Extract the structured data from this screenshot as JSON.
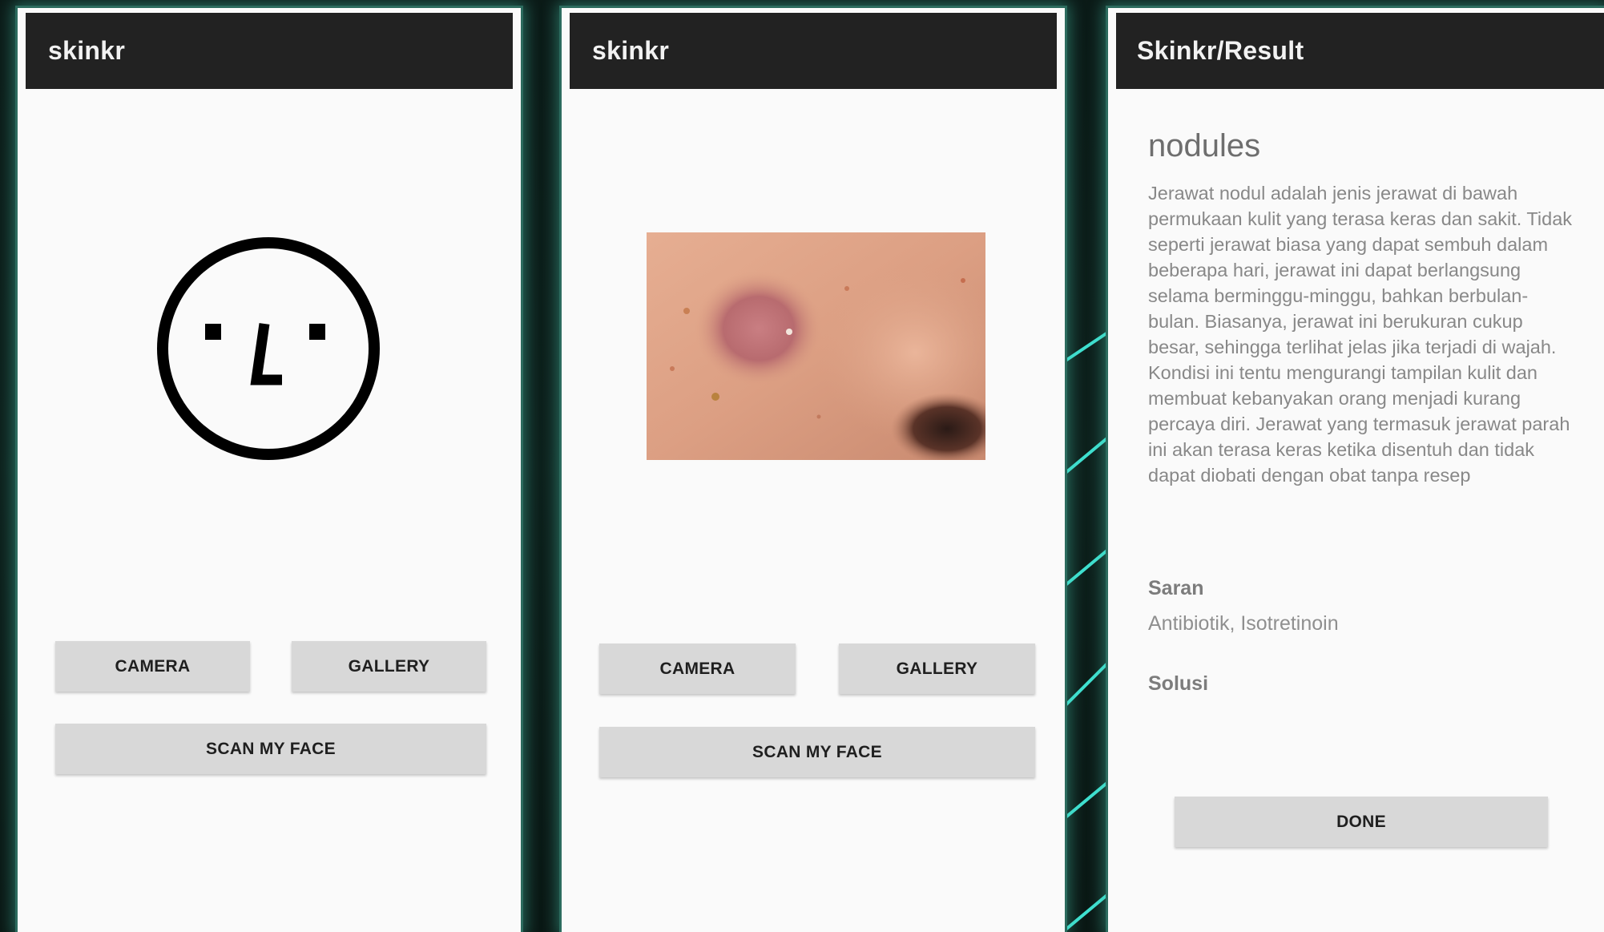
{
  "screens": [
    {
      "title": "skinkr",
      "buttons": {
        "camera": "CAMERA",
        "gallery": "GALLERY",
        "scan": "SCAN MY FACE"
      }
    },
    {
      "title": "skinkr",
      "buttons": {
        "camera": "CAMERA",
        "gallery": "GALLERY",
        "scan": "SCAN MY FACE"
      }
    },
    {
      "title": "Skinkr/Result",
      "result": {
        "condition": "nodules",
        "description": "Jerawat nodul adalah jenis jerawat di bawah permukaan kulit yang terasa keras dan sakit. Tidak seperti jerawat biasa yang dapat sembuh dalam beberapa hari, jerawat ini dapat berlangsung selama berminggu-minggu, bahkan berbulan-bulan. Biasanya, jerawat ini berukuran cukup besar, sehingga terlihat jelas jika terjadi di wajah. Kondisi ini tentu mengurangi tampilan kulit dan membuat kebanyakan orang menjadi kurang percaya diri. Jerawat yang termasuk jerawat parah ini akan terasa keras ketika disentuh dan tidak dapat diobati dengan obat tanpa resep",
        "saran_label": "Saran",
        "saran_value": "Antibiotik, Isotretinoin",
        "solusi_label": "Solusi"
      },
      "buttons": {
        "done": "DONE"
      }
    }
  ],
  "colors": {
    "appbar": "#222222",
    "screen_bg": "#fafafa",
    "button_bg": "#d8d8d8",
    "frame_glow": "#48c8af",
    "deco_lines": "#3fe0d0"
  }
}
